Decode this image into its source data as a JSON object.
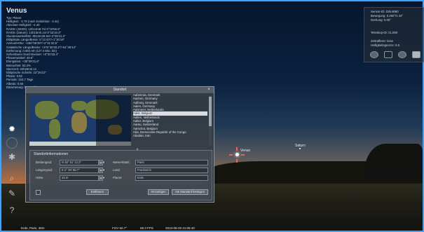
{
  "object": {
    "name": "Venus",
    "info_lines": [
      "Typ: Planet",
      "Helligkeit: -3.79 (nach Extinktion: -3.44)",
      "Absolute Helligkeit: -4.40",
      "RA/DE (J2000): 12h14m8.7s/-0°10'56.5\"",
      "RA/DE (Datum): 12h15m0.1s/-0°16'34.3\"",
      "Stundenwinkel/DE: 8h12m28.5s/+4°05'31.3\"",
      "Ekliptikale Länge/Breite: 5°21'43\"/+1°30'18\"",
      "Azimut/Höhe: +256°58'39\"/+2°31'42.5\"",
      "Galaktische Länge/Breite: +276°40'40.2\"/+61°36'44\"",
      "Entfernung: 0.852 AE (127.4 Mio. km)",
      "Scheinbarer Durchmesser: +0°00'18.4\"",
      "Phasenwinkel: 49.6°",
      "Elongation: +38°09'31.6\"",
      "Beleuchtet: 82.4%",
      "Sternzeit: 20h26m0.1s",
      "Ekliptische Schiefe: 23°26'10\"",
      "Phase: 0.82",
      "Periode: 224.7 Tage",
      "Albedo: 0.65",
      "Dämmerung: bürgerlich"
    ]
  },
  "top_right_panel": {
    "lines": [
      "Sensor-ID: 035.9080",
      "Bewegung: 0.250°/s 44°",
      "Drehung: 0.00°",
      "",
      "Teleskop-ID: CLX80",
      "",
      "Zeitrafferer: leise",
      "Helligkeitsgrenze: 6.5"
    ],
    "buttons": [
      "circle-button",
      "rect-button",
      "circle-button",
      "fill-button"
    ]
  },
  "left_toolbar": {
    "icons": [
      "sun-ring-icon",
      "location-star-icon",
      "gear-icon",
      "search-icon",
      "settings-wrench-icon",
      "help-icon"
    ]
  },
  "dialog": {
    "title": "Standort",
    "close_glyph": "×",
    "cities": [
      "Aabenraa, Denmark",
      "Aachen, Germany",
      "Aalborg, Denmark",
      "Aalen, Germany",
      "Aalsmeer, Netherlands",
      "Aalst, Belgium",
      "Aalten, Netherlands",
      "Aalter, Belgium",
      "Aarau, Switzerland",
      "Aarschot, Belgium",
      "Aba, Democratic Republic of the Congo",
      "Abadan, Iran"
    ],
    "selected_city_index": 5,
    "search_glyph": "⌕",
    "form": {
      "header": "Standortinformationen",
      "longitude_label": "Breitengrad:",
      "longitude_value": "N 48° 51' 12.2\"",
      "latitude_label": "Längengrad:",
      "latitude_value": "E 2° 20' 55.7\"",
      "altitude_label": "Höhe:",
      "altitude_value": "34 m",
      "name_label": "Name/Stadt:",
      "name_value": "Paris",
      "country_label": "Land:",
      "country_value": "Frankreich",
      "planet_label": "Planet:",
      "planet_value": "Erde",
      "delete_button": "Entfernen",
      "add_button": "Hinzufügen",
      "default_button": "Als Standard festlegen",
      "spin_glyph": "▲▼",
      "dropdown_glyph": "▾"
    }
  },
  "sky_labels": {
    "venus": "Venus",
    "saturn": "Saturn"
  },
  "statusbar": {
    "location": "Erde, Paris, 38m",
    "fov": "FOV 50.7°",
    "fps": "59.3 FPS",
    "datetime": "2013-09-29   21:05:40"
  },
  "colors": {
    "frame_accent": "#3da4ff",
    "venus_marker": "#ff5a4a"
  }
}
